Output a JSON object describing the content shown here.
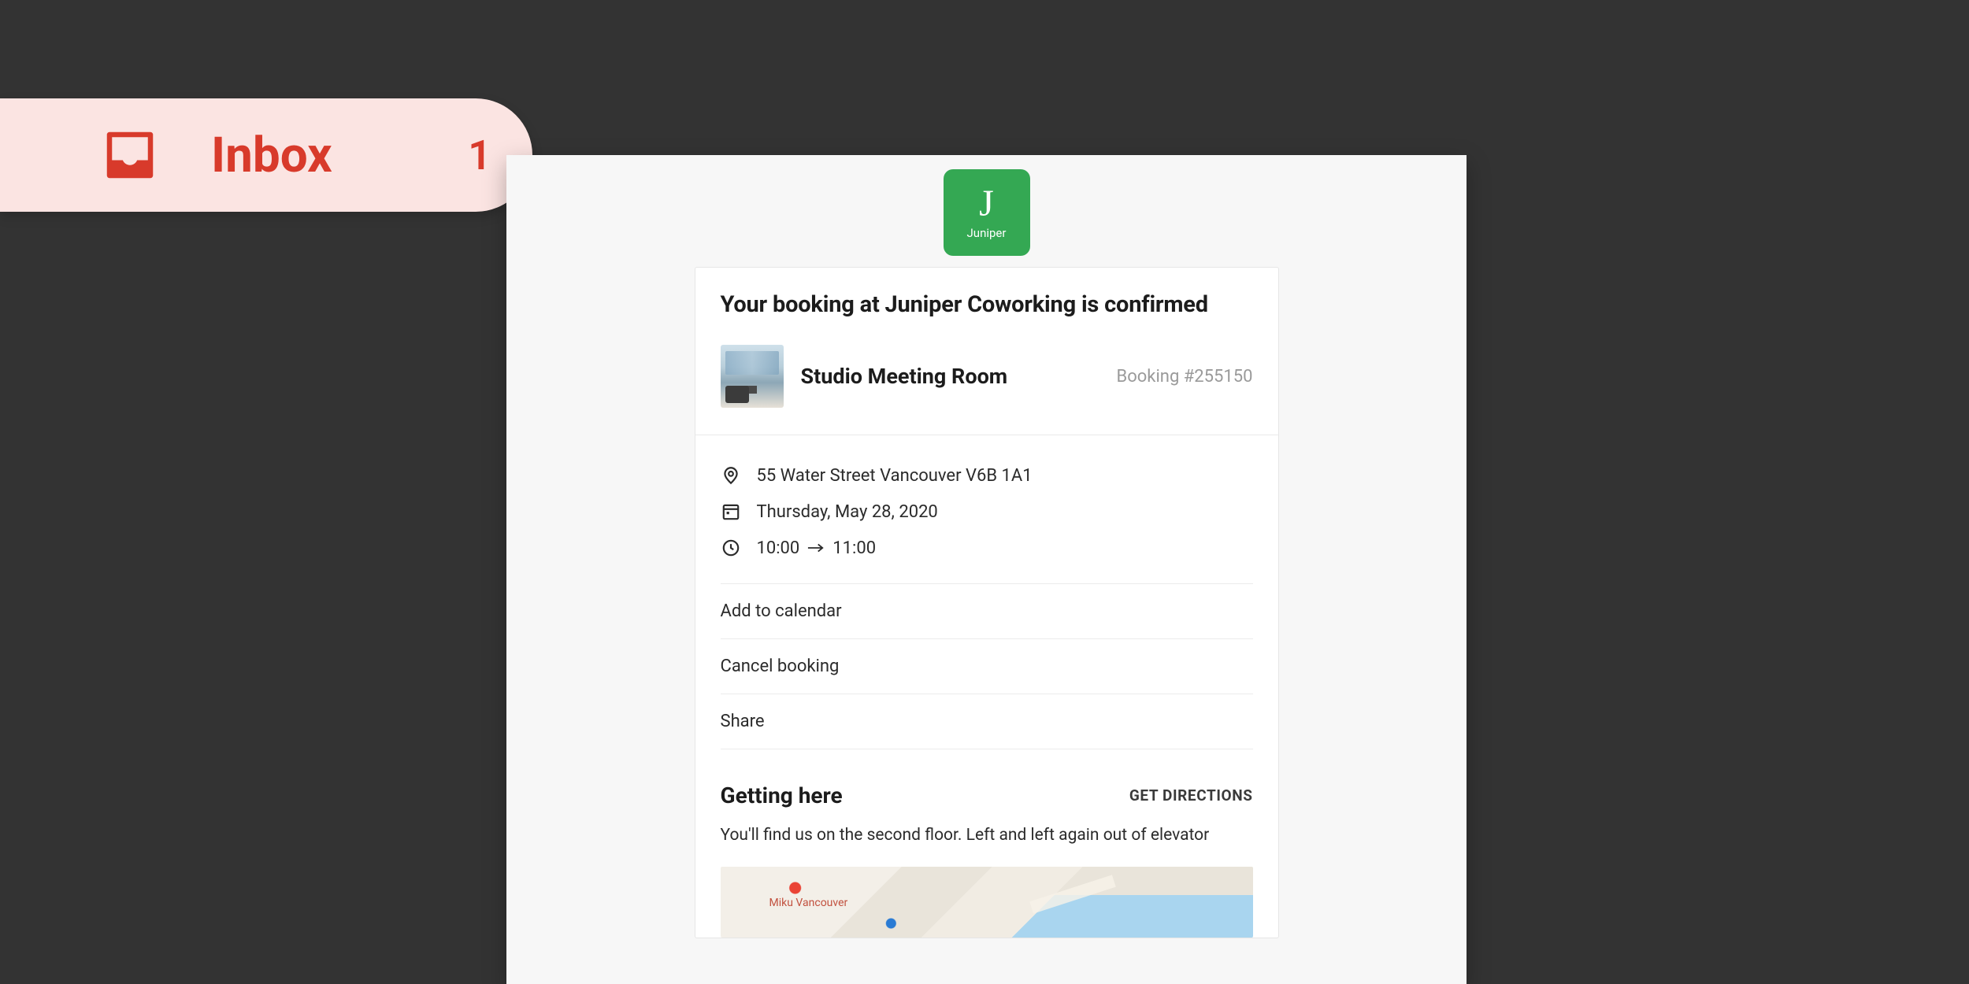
{
  "inbox": {
    "label": "Inbox",
    "count": "1"
  },
  "brand": {
    "letter": "J",
    "name": "Juniper"
  },
  "email": {
    "title": "Your booking at Juniper Coworking is confirmed",
    "room_name": "Studio Meeting Room",
    "booking_number": "Booking #255150",
    "address": "55 Water Street Vancouver V6B 1A1",
    "date": "Thursday, May 28, 2020",
    "time_start": "10:00",
    "time_end": "11:00",
    "actions": {
      "add_to_calendar": "Add to calendar",
      "cancel_booking": "Cancel booking",
      "share": "Share"
    },
    "getting_here": {
      "title": "Getting here",
      "get_directions": "GET DIRECTIONS",
      "description": "You'll find us on the second floor. Left and left again out of elevator",
      "map_label": "Miku Vancouver"
    }
  }
}
